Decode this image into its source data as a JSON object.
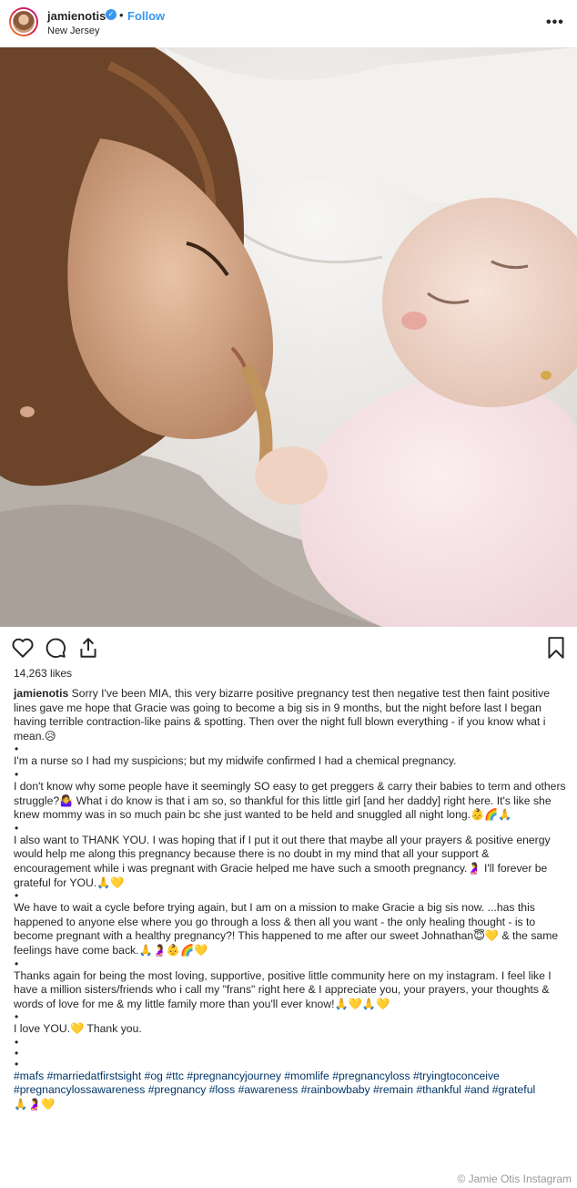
{
  "header": {
    "username": "jamienotis",
    "separator": "•",
    "follow_label": "Follow",
    "location": "New Jersey",
    "more_label": "•••"
  },
  "photo": {
    "alt": "Mother lying next to sleeping baby in pink outfit"
  },
  "actions": {
    "like_icon": "heart-icon",
    "comment_icon": "comment-icon",
    "share_icon": "share-icon",
    "save_icon": "bookmark-icon"
  },
  "likes": "14,263 likes",
  "caption": {
    "username": "jamienotis",
    "p1": " Sorry I've been MIA, this very bizarre positive pregnancy test then negative test then faint positive lines gave me hope that Gracie was going to become a big sis in 9 months, but the night before last I began having terrible contraction-like pains & spotting. Then over the night full blown everything - if you know what i mean.😥",
    "p2": "I'm a nurse so I had my suspicions; but my midwife confirmed I had a chemical pregnancy.",
    "p3": "I don't know why some people have it seemingly SO easy to get preggers & carry their babies to term and others struggle?🤷‍♀️ What i do know is that i am so, so thankful for this little girl [and her daddy] right here. It's like she knew mommy was in so much pain bc she just wanted to be held and snuggled all night long.👶🌈🙏",
    "p4": "I also want to THANK YOU. I was hoping that if I put it out there that maybe all your prayers & positive energy would help me along this pregnancy because there is no doubt in my mind that all your support & encouragement while i was pregnant with Gracie helped me have such a smooth pregnancy.🤰 I'll forever be grateful for YOU.🙏💛",
    "p5": "We have to wait a cycle before trying again, but I am on a mission to make Gracie a big sis now. ...has this happened to anyone else where you go through a loss & then all you want - the only healing thought - is to become pregnant with a healthy pregnancy?! This happened to me after our sweet Johnathan😇💛 & the same feelings have come back.🙏🤰👶🌈💛",
    "p6": "Thanks again for being the most loving, supportive, positive little community here on my instagram. I feel like I have a million sisters/friends who i call my \"frans\" right here & I appreciate you, your prayers, your thoughts & words of love for me & my little family more than you'll ever know!🙏💛🙏💛",
    "p7": "I love YOU.💛 Thank you.",
    "bullet": "•",
    "tags": "#mafs #marriedatfirstsight #og #ttc #pregnancyjourney #momlife #pregnancyloss #tryingtoconceive #pregnancylossawareness #pregnancy #loss #awareness #rainbowbaby #remain #thankful #and #grateful",
    "end_emoji": "🙏🤰💛"
  },
  "credit": "© Jamie Otis Instagram",
  "colors": {
    "link_blue": "#3897f0",
    "hashtag": "#003569",
    "text": "#262626"
  }
}
